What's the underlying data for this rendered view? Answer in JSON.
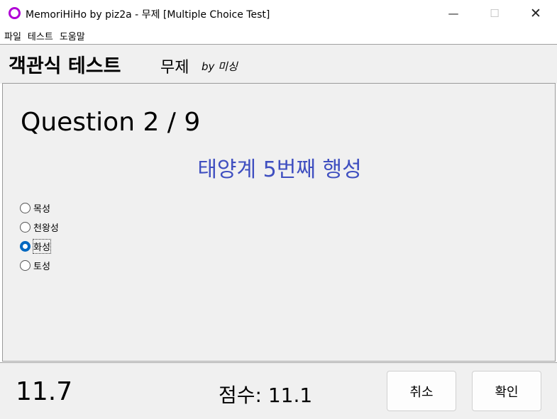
{
  "window": {
    "title": "MemoriHiHo by piz2a - 무제 [Multiple Choice Test]",
    "minimize": "—",
    "maximize": "☐",
    "close": "✕"
  },
  "menu": [
    "파일",
    "테스트",
    "도움말"
  ],
  "header": {
    "title": "객관식 테스트",
    "subtitle": "무제",
    "author": "by 미싱"
  },
  "question": {
    "counter": "Question 2 / 9",
    "prompt": "태양계 5번째 행성",
    "prompt_color": "#3f4fc0",
    "options": [
      "목성",
      "천왕성",
      "화성",
      "토성"
    ],
    "selected": "화성"
  },
  "footer": {
    "timer": "11.7",
    "score": "점수: 11.1",
    "cancel_label": "취소",
    "ok_label": "확인"
  },
  "colors": {
    "accent": "#0067c0",
    "app_icon": "#b000d6"
  }
}
